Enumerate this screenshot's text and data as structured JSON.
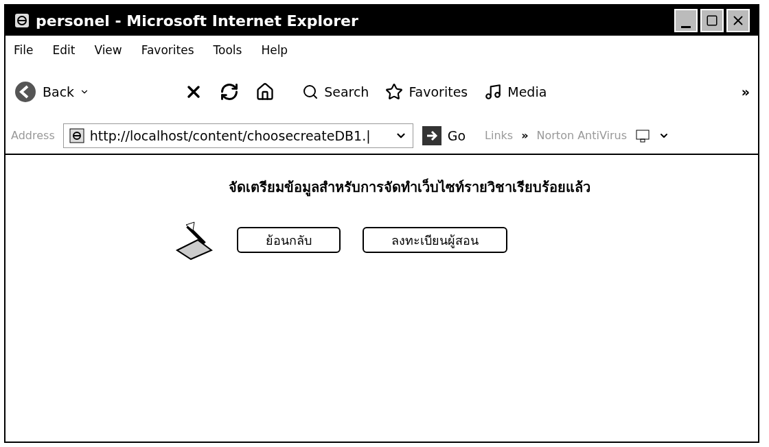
{
  "window": {
    "title": "personel - Microsoft Internet Explorer"
  },
  "menu": [
    {
      "label": "File"
    },
    {
      "label": "Edit"
    },
    {
      "label": "View"
    },
    {
      "label": "Favorites"
    },
    {
      "label": "Tools"
    },
    {
      "label": "Help"
    }
  ],
  "toolbar": {
    "back": "Back",
    "search": "Search",
    "favorites": "Favorites",
    "media": "Media",
    "overflow": "»"
  },
  "address_bar": {
    "label": "Address",
    "url": "http://localhost/content/choosecreateDB1.|",
    "go": "Go",
    "links": "Links",
    "links_overflow": "»",
    "norton": "Norton AntiVirus"
  },
  "page": {
    "heading": "จัดเตรียมข้อมูลสำหรับการจัดทำเว็บไซท์รายวิชาเรียบร้อยแล้ว",
    "buttons": [
      {
        "label": "ย้อนกลับ"
      },
      {
        "label": "ลงทะเบียนผู้สอน"
      }
    ]
  }
}
